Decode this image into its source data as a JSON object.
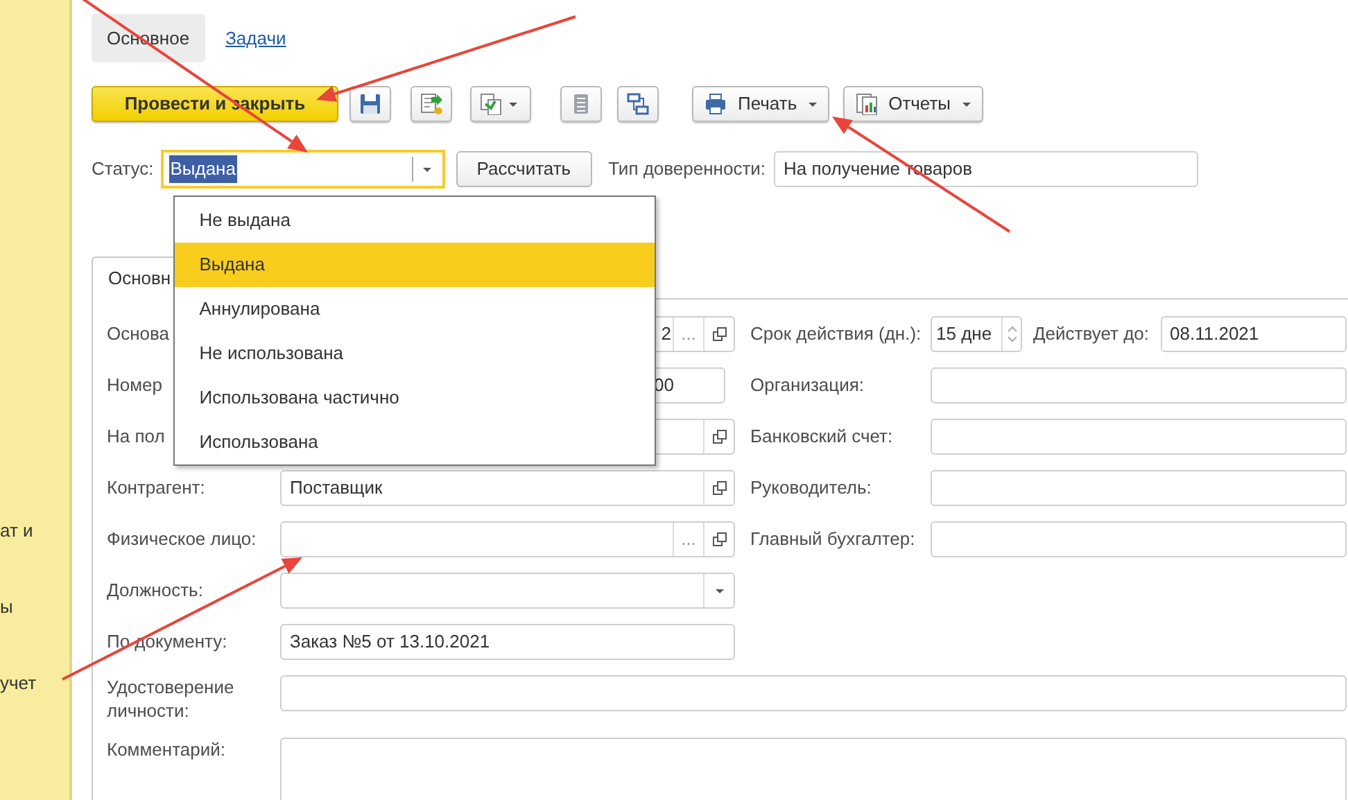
{
  "sidebar": {
    "fragments": [
      "ат и",
      "ы",
      "учет"
    ]
  },
  "page_tabs": [
    {
      "label": "Основное",
      "selected": true
    },
    {
      "label": "Задачи",
      "selected": false
    }
  ],
  "toolbar": [
    {
      "kind": "primary",
      "label": "Провести и закрыть"
    },
    {
      "kind": "icon"
    },
    {
      "kind": "icon"
    },
    {
      "kind": "icon-menu"
    },
    {
      "kind": "icon"
    },
    {
      "kind": "icon"
    },
    {
      "kind": "menu",
      "label": "Печать"
    },
    {
      "kind": "menu",
      "label": "Отчеты"
    }
  ],
  "status": {
    "label": "Статус:",
    "value": "Выдана",
    "focused": true
  },
  "calc_button": "Рассчитать",
  "proxy_type": {
    "label": "Тип доверенности:",
    "value": "На получение товаров"
  },
  "dropdown": {
    "items": [
      {
        "label": "Не выдана",
        "selected": false
      },
      {
        "label": "Выдана",
        "selected": true
      },
      {
        "label": "Аннулирована",
        "selected": false
      },
      {
        "label": "Не использована",
        "selected": false
      },
      {
        "label": "Использована частично",
        "selected": false
      },
      {
        "label": "Использована",
        "selected": false
      }
    ]
  },
  "form_tabs": [
    {
      "label": "Основн",
      "selected": true
    }
  ],
  "left_fields": [
    {
      "label": "Основа",
      "value": "2",
      "kind": "choose-open",
      "choose_label": "..."
    },
    {
      "label": "Номер",
      "value": "00",
      "kind": "short"
    },
    {
      "label": "На пол",
      "kind": "open"
    },
    {
      "label": "Контрагент:",
      "value": "Поставщик",
      "kind": "open"
    },
    {
      "label": "Физическое лицо:",
      "kind": "choose-open",
      "choose_label": "..."
    },
    {
      "label": "Должность:",
      "kind": "select"
    },
    {
      "label": "По документу:",
      "value": "Заказ №5 от 13.10.2021",
      "kind": "text"
    },
    {
      "label": "Удостоверение личности:",
      "kind": "wide"
    },
    {
      "label": "Комментарий:",
      "kind": "memo"
    }
  ],
  "right_fields": [
    {
      "label": "Срок действия (дн.):",
      "value": "15 дне",
      "kind": "period",
      "label2": "Действует до:",
      "value2": "08.11.2021"
    },
    {
      "label": "Организация:",
      "kind": "text"
    },
    {
      "label": "Банковский счет:",
      "kind": "text"
    },
    {
      "label": "Руководитель:",
      "kind": "text"
    },
    {
      "label": "Главный бухгалтер:",
      "kind": "text"
    }
  ]
}
